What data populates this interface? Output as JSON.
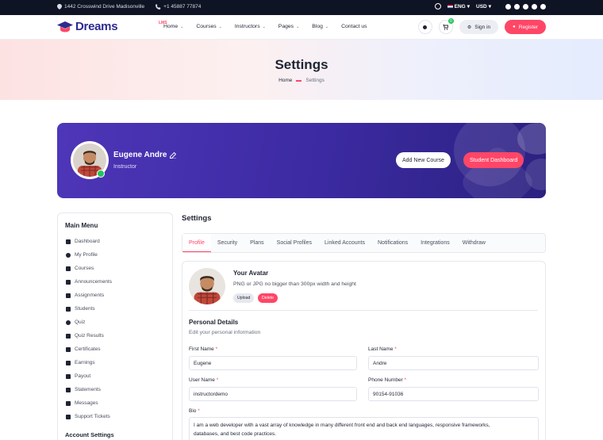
{
  "topbar": {
    "address": "1442 Crosswind Drive Madisonville",
    "phone": "+1 45887 77874",
    "language": "ENG",
    "currency": "USD"
  },
  "header": {
    "logo": "Dreams",
    "logo_sup": "LMS",
    "nav": [
      "Home",
      "Courses",
      "Instructors",
      "Pages",
      "Blog",
      "Contact us"
    ],
    "cart_count": "0",
    "signin": "Sign in",
    "register": "Register"
  },
  "banner": {
    "title": "Settings",
    "crumb_home": "Home",
    "crumb_current": "Settings"
  },
  "profile": {
    "name": "Eugene Andre",
    "role": "Instructor",
    "add_course": "Add New Course",
    "dashboard": "Student Dashboard"
  },
  "sidebar": {
    "title": "Main Menu",
    "items": [
      "Dashboard",
      "My Profile",
      "Courses",
      "Announcements",
      "Assignments",
      "Students",
      "Quiz",
      "Quiz Results",
      "Certificates",
      "Earnings",
      "Payout",
      "Statements",
      "Messages",
      "Support Tickets"
    ],
    "account_title": "Account Settings"
  },
  "main": {
    "title": "Settings",
    "tabs": [
      "Profile",
      "Security",
      "Plans",
      "Social Profiles",
      "Linked Accounts",
      "Notifications",
      "Integrations",
      "Withdraw"
    ],
    "avatar_title": "Your Avatar",
    "avatar_hint": "PNG or JPG no bigger than 300px width and height",
    "upload": "Upload",
    "delete": "Delete",
    "personal_title": "Personal Details",
    "personal_sub": "Edit your personal information",
    "first_name_label": "First Name",
    "first_name": "Eugene",
    "last_name_label": "Last Name",
    "last_name": "Andre",
    "user_name_label": "User Name",
    "user_name": "instructordemo",
    "phone_label": "Phone Number",
    "phone": "90154-91036",
    "bio_label": "Bio",
    "bio_line1": "I am a web developer with a vast array of knowledge in many different front end and back end languages, responsive frameworks,",
    "bio_line2": "databases, and best code practices.",
    "required_mark": "*"
  },
  "colors": {
    "accent": "#ff4667",
    "brand": "#2e2a8f",
    "hero": "#3b2aa1"
  }
}
